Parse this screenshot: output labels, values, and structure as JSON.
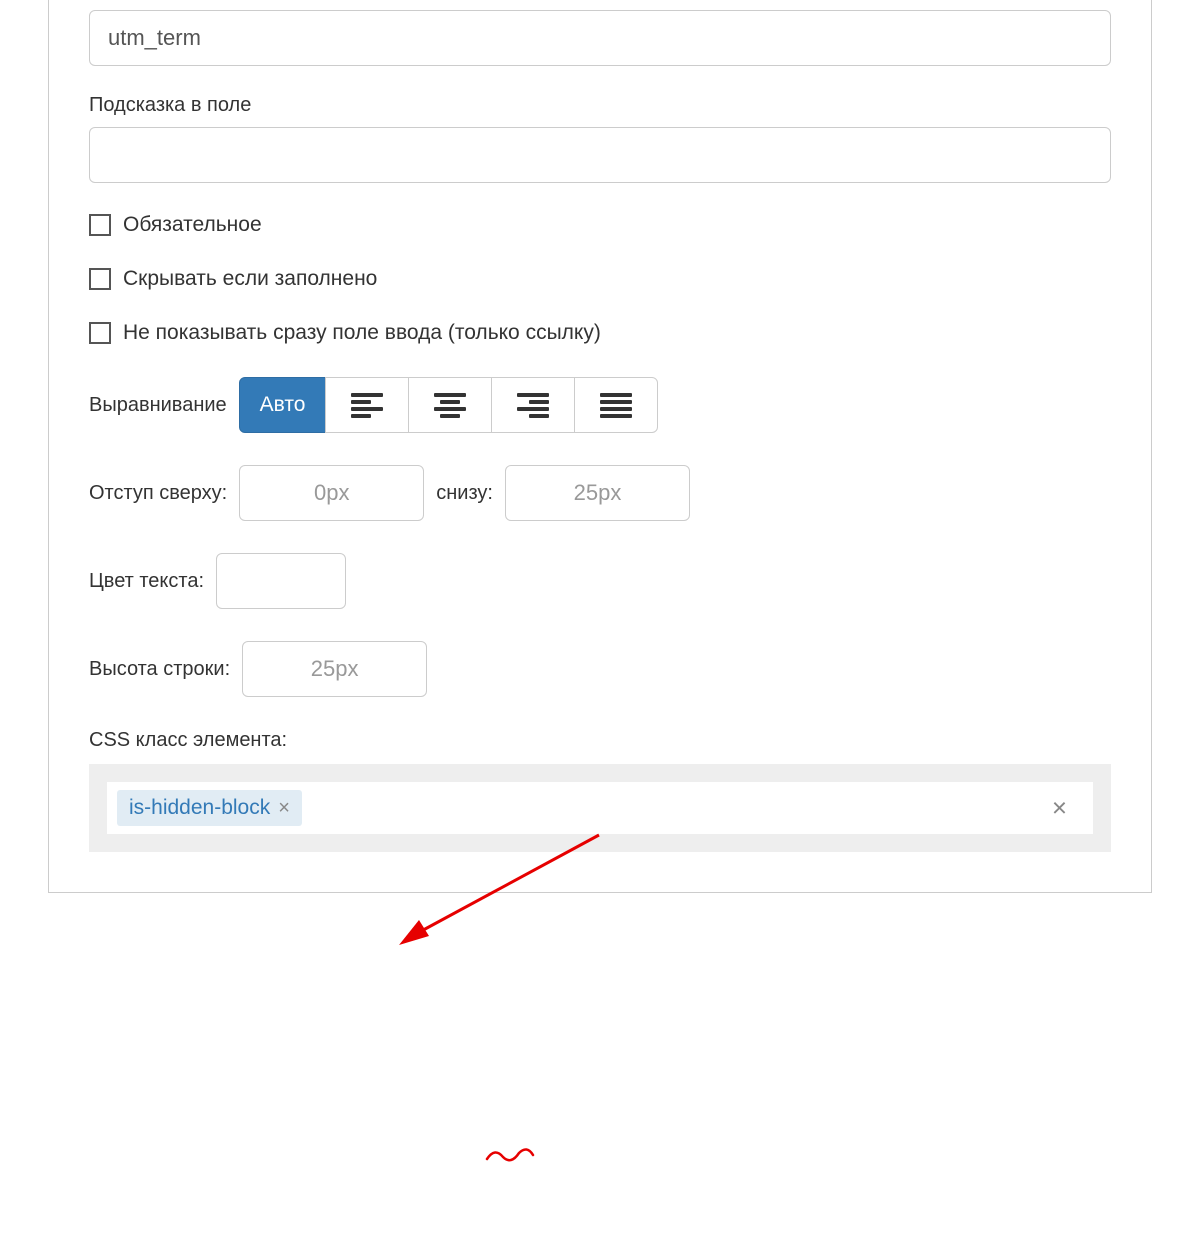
{
  "fields": {
    "name_value": "utm_term",
    "hint_label": "Подсказка в поле",
    "hint_value": ""
  },
  "checkboxes": {
    "required": "Обязательное",
    "hide_if_filled": "Скрывать если заполнено",
    "hide_input_show_link": "Не показывать сразу поле ввода (только ссылку)"
  },
  "alignment": {
    "label": "Выравнивание",
    "auto": "Авто"
  },
  "spacing": {
    "top_label": "Отступ сверху:",
    "top_placeholder": "0px",
    "bottom_label": "снизу:",
    "bottom_placeholder": "25px"
  },
  "text_color_label": "Цвет текста:",
  "line_height": {
    "label": "Высота строки:",
    "placeholder": "25px"
  },
  "css_class": {
    "label": "CSS класс элемента:",
    "tag": "is-hidden-block"
  }
}
